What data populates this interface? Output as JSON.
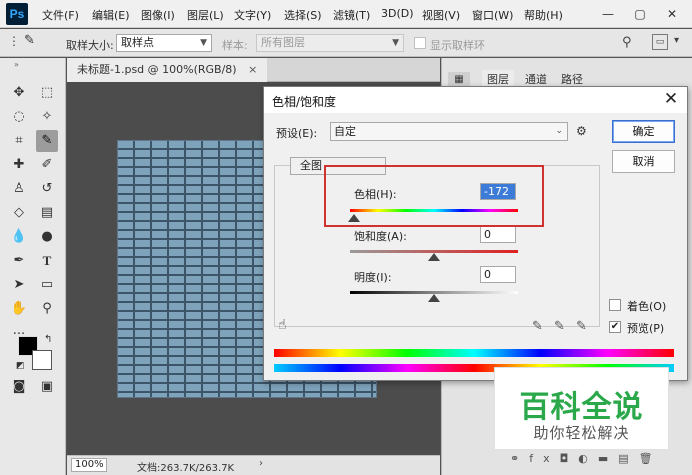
{
  "menubar": {
    "logo": "Ps",
    "items": [
      "文件(F)",
      "编辑(E)",
      "图像(I)",
      "图层(L)",
      "文字(Y)",
      "选择(S)",
      "滤镜(T)",
      "3D(D)",
      "视图(V)",
      "窗口(W)",
      "帮助(H)"
    ],
    "window_controls": [
      "—",
      "▢",
      "✕"
    ]
  },
  "options_bar": {
    "sample_size_label": "取样大小:",
    "sample_size_value": "取样点",
    "sample_label": "样本:",
    "sample_value": "所有图层",
    "show_ring_label": "显示取样环"
  },
  "document": {
    "tab_title": "未标题-1.psd @ 100%(RGB/8)",
    "tab_close": "×",
    "zoom": "100%",
    "doc_info": "文档:263.7K/263.7K"
  },
  "right_panel": {
    "tabs": [
      "图层",
      "通道",
      "路径"
    ]
  },
  "dialog": {
    "title": "色相/饱和度",
    "close": "✕",
    "preset_label": "预设(E):",
    "preset_value": "自定",
    "channel_value": "全图",
    "hue_label": "色相(H):",
    "hue_value": "-172",
    "saturation_label": "饱和度(A):",
    "saturation_value": "0",
    "lightness_label": "明度(I):",
    "lightness_value": "0",
    "ok_label": "确定",
    "cancel_label": "取消",
    "colorize_label": "着色(O)",
    "colorize_checked": false,
    "preview_label": "预览(P)",
    "preview_checked": true,
    "hue_slider_level": -172,
    "saturation_slider_level": 0,
    "lightness_slider_level": 0
  },
  "watermark": {
    "title": "百科全说",
    "subtitle": "助你轻松解决"
  },
  "colors": {
    "highlight_box": "#d03232",
    "watermark_green": "#2aa84a"
  }
}
